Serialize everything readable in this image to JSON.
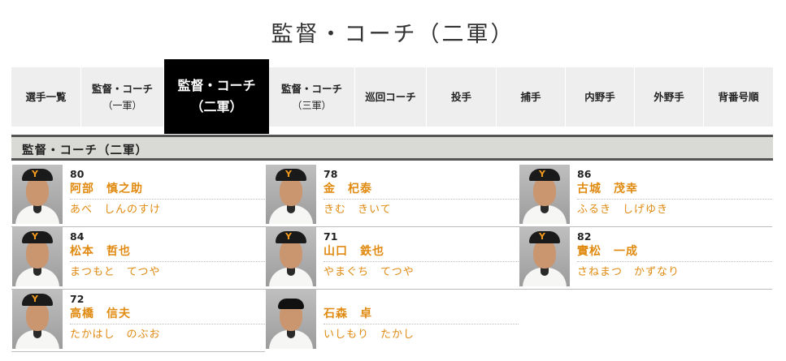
{
  "page": {
    "title": "監督・コーチ（二軍）"
  },
  "tabs": [
    {
      "label": "選手一覧",
      "sub": ""
    },
    {
      "label": "監督・コーチ",
      "sub": "（一軍）"
    },
    {
      "label": "監督・コーチ",
      "sub": "（二軍）"
    },
    {
      "label": "監督・コーチ",
      "sub": "（三軍）"
    },
    {
      "label": "巡回コーチ",
      "sub": ""
    },
    {
      "label": "投手",
      "sub": ""
    },
    {
      "label": "捕手",
      "sub": ""
    },
    {
      "label": "内野手",
      "sub": ""
    },
    {
      "label": "外野手",
      "sub": ""
    },
    {
      "label": "背番号順",
      "sub": ""
    }
  ],
  "section": {
    "title": "監督・コーチ（二軍）"
  },
  "staff": [
    {
      "number": "80",
      "name": "阿部　慎之助",
      "kana": "あべ　しんのすけ"
    },
    {
      "number": "78",
      "name": "金　杞泰",
      "kana": "きむ　きいて"
    },
    {
      "number": "86",
      "name": "古城　茂幸",
      "kana": "ふるき　しげゆき"
    },
    {
      "number": "84",
      "name": "松本　哲也",
      "kana": "まつもと　てつや"
    },
    {
      "number": "71",
      "name": "山口　鉄也",
      "kana": "やまぐち　てつや"
    },
    {
      "number": "82",
      "name": "實松　一成",
      "kana": "さねまつ　かずなり"
    },
    {
      "number": "72",
      "name": "高橋　信夫",
      "kana": "たかはし　のぶお"
    },
    {
      "number": "",
      "name": "石森　卓",
      "kana": "いしもり　たかし"
    }
  ],
  "colors": {
    "accent": "#e08a10",
    "active_tab": "#000000",
    "tab_bg": "#eeeeee",
    "section_bg": "#d9d9d5"
  }
}
